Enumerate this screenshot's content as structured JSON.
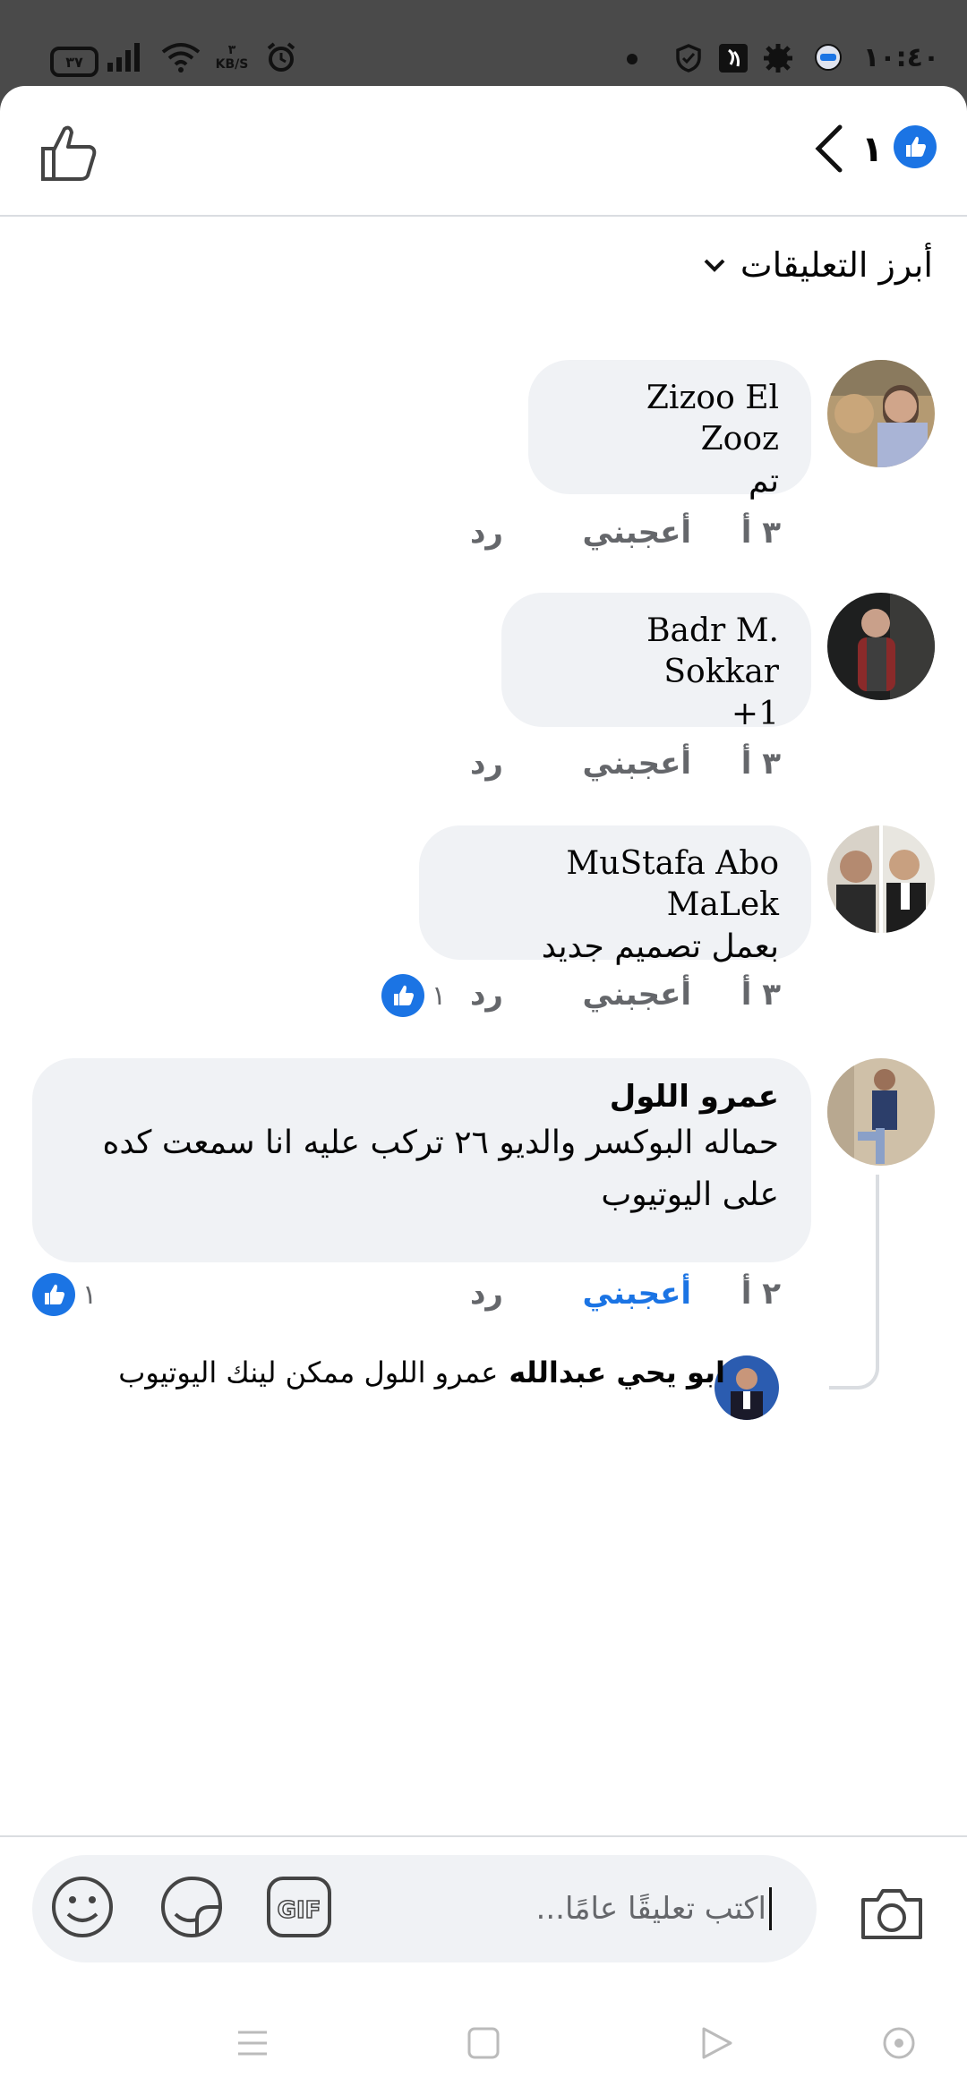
{
  "status_bar": {
    "battery": "٣٧",
    "net_speed_value": "٣",
    "net_speed_unit": "KB/S",
    "time": "١٠:٤٠",
    "icons": [
      "signal-icon",
      "wifi-icon",
      "alarm-icon",
      "shield-icon",
      "app-icon",
      "gear-icon",
      "messenger-icon"
    ]
  },
  "header": {
    "reaction_count": "١",
    "icons": [
      "thumbs-up-outline-icon",
      "back-chevron-icon",
      "like-badge-icon"
    ]
  },
  "sort": {
    "label": "أبرز التعليقات"
  },
  "comments": [
    {
      "author": "Zizoo El Zooz",
      "text": "تم",
      "time": "٣ أ",
      "like": "أعجبني",
      "reply": "رد"
    },
    {
      "author": "Badr M. Sokkar",
      "text": "1+",
      "time": "٣ أ",
      "like": "أعجبني",
      "reply": "رد"
    },
    {
      "author": "MuStafa Abo MaLek",
      "text": "بعمل تصميم جديد",
      "time": "٣ أ",
      "like": "أعجبني",
      "reply": "رد",
      "reactions": "١"
    },
    {
      "author": "عمرو اللول",
      "text": "حماله البوكسر والديو ٢٦ تركب عليه انا سمعت كده على اليوتيوب",
      "time": "٢ أ",
      "like": "أعجبني",
      "reply": "رد",
      "reactions": "١",
      "liked": true
    }
  ],
  "reply_preview": {
    "author": "ابو يحي عبدالله",
    "text": "عمرو اللول ممكن لينك اليوتيوب"
  },
  "composer": {
    "placeholder": "اكتب تعليقًا عامًا...",
    "gif_label": "GIF"
  },
  "colors": {
    "accent": "#1b74e4",
    "bubble": "#f0f2f5",
    "meta": "#65676b"
  }
}
